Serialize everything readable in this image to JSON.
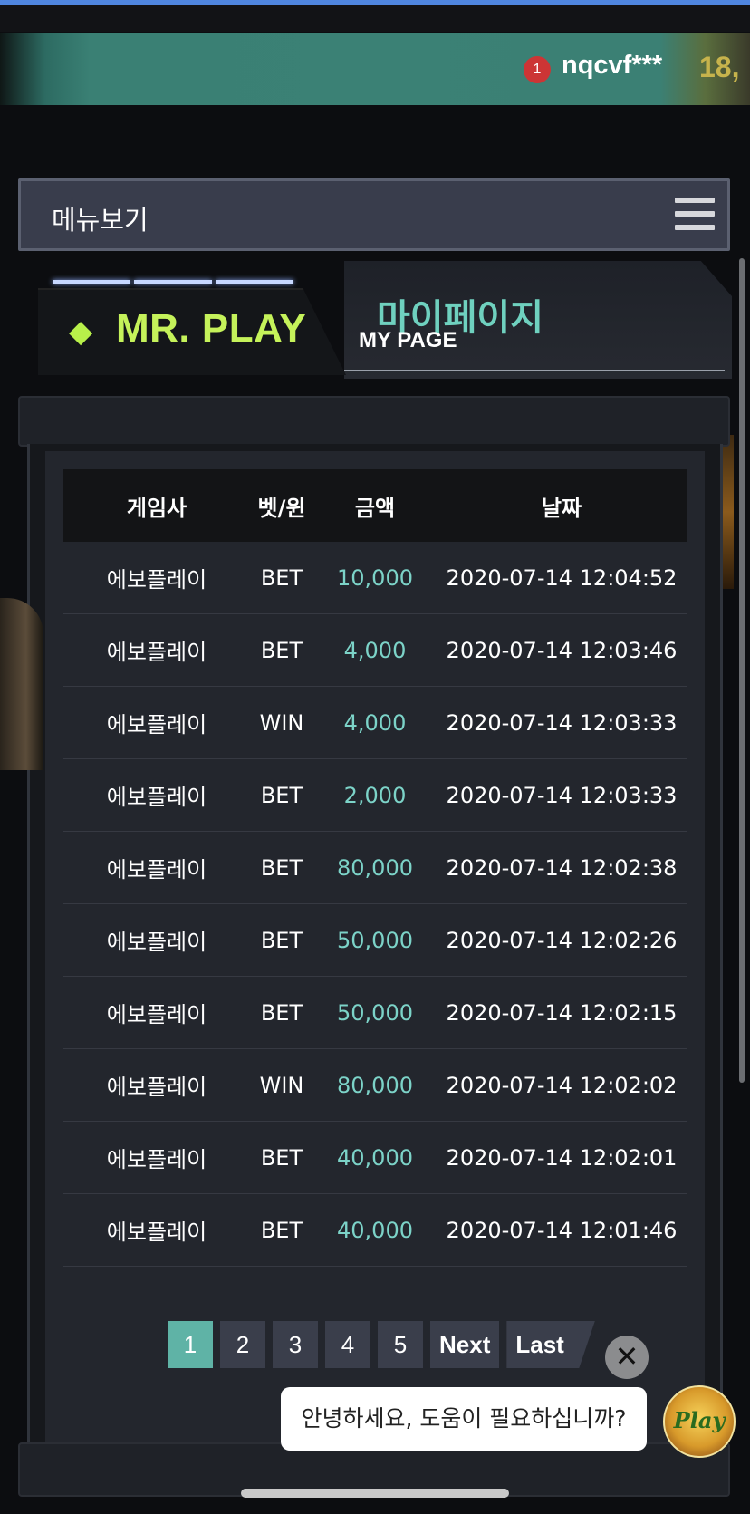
{
  "header": {
    "notification_count": "1",
    "username": "nqcvf***",
    "balance_partial": "18,"
  },
  "menu": {
    "label": "메뉴보기"
  },
  "brand": {
    "logo_text": "MR. PLAY",
    "gem_icon": "diamond-icon"
  },
  "page": {
    "title_ko": "마이페이지",
    "title_en": "MY PAGE"
  },
  "table": {
    "headers": [
      "게임사",
      "벳/윈",
      "금액",
      "날짜"
    ],
    "rows": [
      [
        "에보플레이",
        "BET",
        "10,000",
        "2020-07-14 12:04:52"
      ],
      [
        "에보플레이",
        "BET",
        "4,000",
        "2020-07-14 12:03:46"
      ],
      [
        "에보플레이",
        "WIN",
        "4,000",
        "2020-07-14 12:03:33"
      ],
      [
        "에보플레이",
        "BET",
        "2,000",
        "2020-07-14 12:03:33"
      ],
      [
        "에보플레이",
        "BET",
        "80,000",
        "2020-07-14 12:02:38"
      ],
      [
        "에보플레이",
        "BET",
        "50,000",
        "2020-07-14 12:02:26"
      ],
      [
        "에보플레이",
        "BET",
        "50,000",
        "2020-07-14 12:02:15"
      ],
      [
        "에보플레이",
        "WIN",
        "80,000",
        "2020-07-14 12:02:02"
      ],
      [
        "에보플레이",
        "BET",
        "40,000",
        "2020-07-14 12:02:01"
      ],
      [
        "에보플레이",
        "BET",
        "40,000",
        "2020-07-14 12:01:46"
      ]
    ]
  },
  "pagination": {
    "pages": [
      "1",
      "2",
      "3",
      "4",
      "5"
    ],
    "active_page": "1",
    "next_label": "Next",
    "last_label": "Last"
  },
  "chat": {
    "message": "안녕하세요, 도움이 필요하십니까?",
    "close_symbol": "✕",
    "avatar_text": "Play"
  },
  "colors": {
    "accent_teal": "#5fb3a6",
    "amount_color": "#7cd3c8",
    "logo_green": "#c5f25a",
    "badge_red": "#cc3535"
  }
}
